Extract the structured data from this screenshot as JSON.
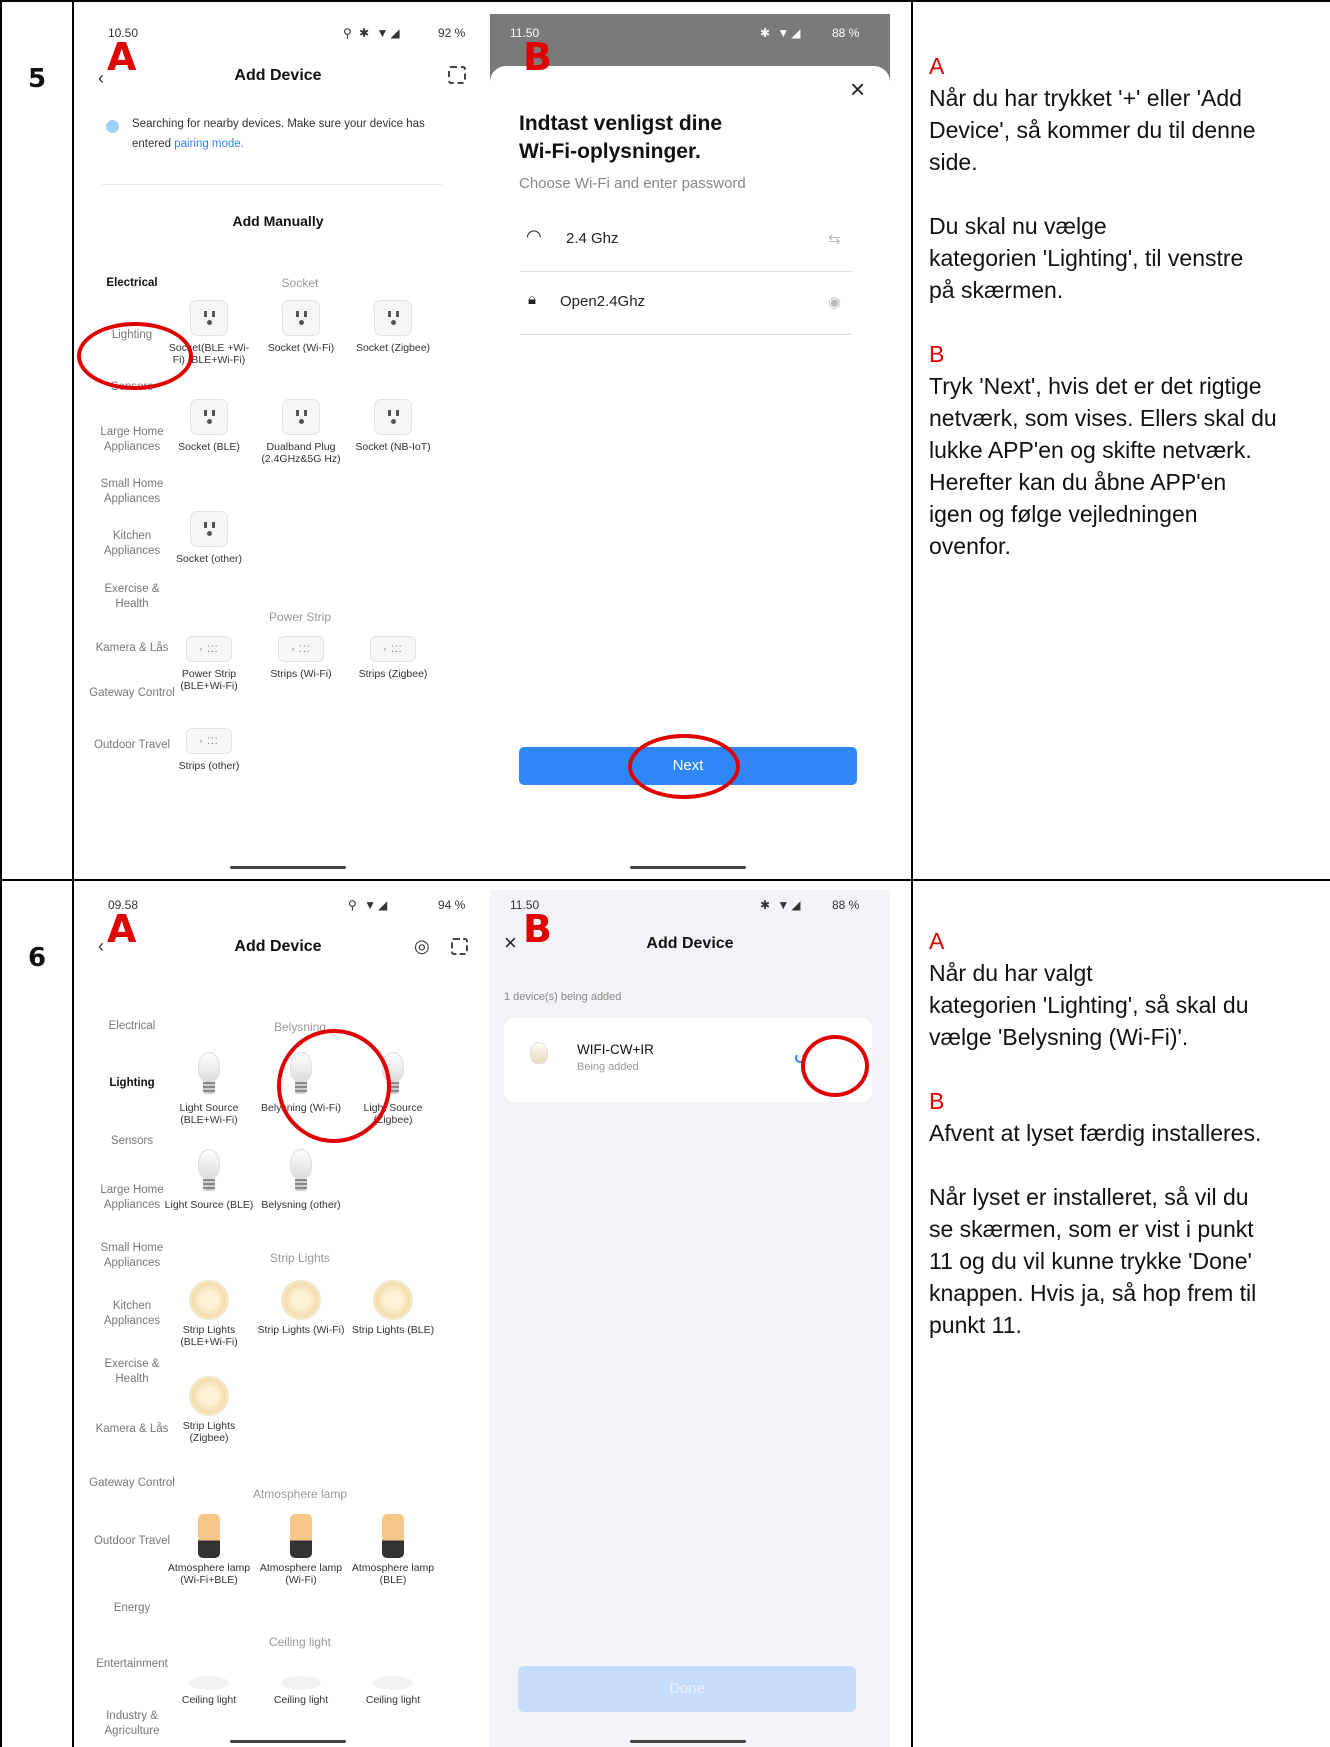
{
  "rows": [
    {
      "number": "5",
      "left_screen": {
        "letter": "A",
        "status_time": "10.50",
        "status_right": "92 %",
        "title": "Add Device",
        "search_text": "Searching for nearby devices. Make sure your device has",
        "search_text2": "entered",
        "search_link": "pairing mode.",
        "add_manually": "Add Manually",
        "categories": [
          "Electrical",
          "Lighting",
          "Sensors",
          "Large Home Appliances",
          "Small Home Appliances",
          "Kitchen Appliances",
          "Exercise & Health",
          "Kamera & Lås",
          "Gateway Control",
          "Outdoor Travel"
        ],
        "section_socket": "Socket",
        "section_power": "Power Strip",
        "items": [
          "Socket(BLE +Wi-Fi) (BLE+Wi-Fi)",
          "Socket (Wi-Fi)",
          "Socket (Zigbee)",
          "Socket (BLE)",
          "Dualband Plug (2.4GHz&5G Hz)",
          "Socket (NB-IoT)",
          "Socket (other)",
          "Power Strip (BLE+Wi-Fi)",
          "Strips (Wi-Fi)",
          "Strips (Zigbee)",
          "Strips (other)"
        ]
      },
      "right_screen": {
        "letter": "B",
        "status_time": "11.50",
        "status_right": "88 %",
        "close": "×",
        "heading1": "Indtast venligst dine",
        "heading2": "Wi-Fi-oplysninger.",
        "subtitle": "Choose Wi-Fi and enter password",
        "wifi_value": "2.4 Ghz",
        "password_value": "Open2.4Ghz",
        "next_label": "Next"
      },
      "note": {
        "label_a": "A",
        "text_a": [
          "Når du har trykket '+' eller 'Add",
          "Device', så kommer du til denne",
          "side."
        ],
        "text_a2": [
          "Du skal nu vælge",
          "kategorien 'Lighting', til venstre",
          "på skærmen."
        ],
        "label_b": "B",
        "text_b": [
          "Tryk 'Next', hvis det er det rigtige",
          "netværk, som vises. Ellers skal du",
          "lukke APP'en og skifte netværk.",
          "Herefter kan du åbne APP'en",
          "igen og følge vejledningen",
          "ovenfor."
        ]
      }
    },
    {
      "number": "6",
      "left_screen": {
        "letter": "A",
        "status_time": "09.58",
        "status_right": "94 %",
        "title": "Add Device",
        "categories": [
          "Electrical",
          "Lighting",
          "Sensors",
          "Large Home Appliances",
          "Small Home Appliances",
          "Kitchen Appliances",
          "Exercise & Health",
          "Kamera & Lås",
          "Gateway Control",
          "Outdoor Travel",
          "Energy",
          "Entertainment",
          "Industry & Agriculture"
        ],
        "section_belysning": "Belysning",
        "section_strip": "Strip Lights",
        "section_atmo": "Atmosphere lamp",
        "section_ceiling": "Ceiling light",
        "items": [
          "Light Source (BLE+Wi-Fi)",
          "Belysning (Wi-Fi)",
          "Light Source (Zigbee)",
          "Light Source (BLE)",
          "Belysning (other)",
          "Strip Lights (BLE+Wi-Fi)",
          "Strip Lights (Wi-Fi)",
          "Strip Lights (BLE)",
          "Strip Lights (Zigbee)",
          "Atmosphere lamp (Wi-Fi+BLE)",
          "Atmosphere lamp (Wi-Fi)",
          "Atmosphere lamp (BLE)",
          "Ceiling light",
          "Ceiling light",
          "Ceiling light"
        ]
      },
      "right_screen": {
        "letter": "B",
        "status_time": "11.50",
        "status_right": "88 %",
        "close": "×",
        "title": "Add Device",
        "adding_text": "1 device(s) being added",
        "device_name": "WIFI-CW+IR",
        "device_status": "Being added",
        "done_label": "Done"
      },
      "note": {
        "label_a": "A",
        "text_a": [
          "Når du har valgt",
          "kategorien 'Lighting', så skal du",
          "vælge 'Belysning (Wi-Fi)'."
        ],
        "label_b": "B",
        "text_b": [
          "Afvent at lyset færdig installeres."
        ],
        "text_b2": [
          "Når lyset er installeret, så vil du",
          "se skærmen, som er vist i punkt",
          "11 og du vil kunne trykke 'Done'",
          "knappen. Hvis ja, så hop frem til",
          "punkt 11."
        ]
      }
    }
  ],
  "colors": {
    "accent_red": "#e00000",
    "button_blue": "#2f86f6",
    "link_blue": "#2f86f6"
  }
}
